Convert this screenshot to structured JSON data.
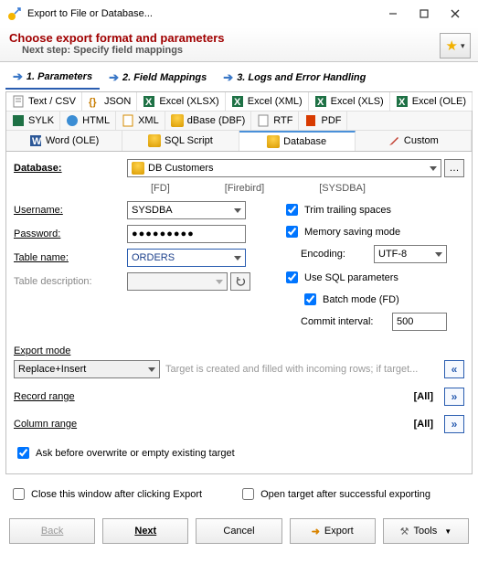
{
  "window": {
    "title": "Export to File or Database..."
  },
  "header": {
    "main": "Choose export format and parameters",
    "sub": "Next step: Specify field mappings"
  },
  "wizard": {
    "tabs": [
      {
        "label": "1. Parameters"
      },
      {
        "label": "2. Field Mappings"
      },
      {
        "label": "3. Logs and Error Handling"
      }
    ]
  },
  "formats": {
    "row1": [
      {
        "label": "Text / CSV"
      },
      {
        "label": "JSON"
      },
      {
        "label": "Excel (XLSX)"
      },
      {
        "label": "Excel (XML)"
      },
      {
        "label": "Excel (XLS)"
      },
      {
        "label": "Excel (OLE)"
      }
    ],
    "row2": [
      {
        "label": "SYLK"
      },
      {
        "label": "HTML"
      },
      {
        "label": "XML"
      },
      {
        "label": "dBase (DBF)"
      },
      {
        "label": "RTF"
      },
      {
        "label": "PDF"
      }
    ],
    "row3": [
      {
        "label": "Word (OLE)"
      },
      {
        "label": "SQL Script"
      },
      {
        "label": "Database"
      },
      {
        "label": "Custom"
      }
    ]
  },
  "db": {
    "label": "Database:",
    "value": "DB Customers",
    "meta1": "[FD]",
    "meta2": "[Firebird]",
    "meta3": "[SYSDBA]"
  },
  "left": {
    "username_label": "Username:",
    "username_value": "SYSDBA",
    "password_label": "Password:",
    "password_value": "●●●●●●●●●",
    "table_label": "Table name:",
    "table_value": "ORDERS",
    "desc_label": "Table description:",
    "desc_value": ""
  },
  "right": {
    "trim": "Trim trailing spaces",
    "memory": "Memory saving mode",
    "encoding_label": "Encoding:",
    "encoding_value": "UTF-8",
    "sqlparams": "Use SQL parameters",
    "batch": "Batch mode (FD)",
    "commit_label": "Commit interval:",
    "commit_value": "500"
  },
  "export_mode": {
    "title": "Export mode",
    "value": "Replace+Insert",
    "hint": "Target is created and filled with incoming rows; if target..."
  },
  "record_range": {
    "title": "Record range",
    "value": "[All]"
  },
  "column_range": {
    "title": "Column range",
    "value": "[All]"
  },
  "ask_overwrite": "Ask before overwrite or empty existing target",
  "footer": {
    "close_after": "Close this window after clicking Export",
    "open_after": "Open target after successful exporting"
  },
  "buttons": {
    "back": "Back",
    "next": "Next",
    "cancel": "Cancel",
    "export": "Export",
    "tools": "Tools"
  }
}
